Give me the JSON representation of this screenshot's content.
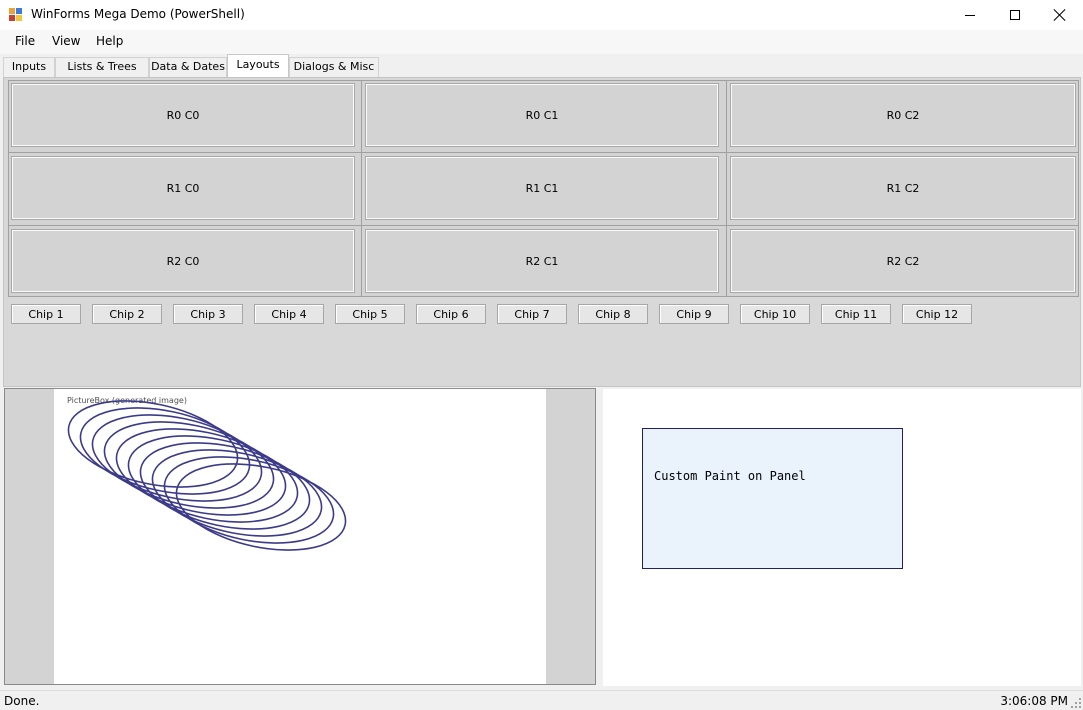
{
  "window": {
    "title": "WinForms Mega Demo (PowerShell)",
    "icon": "app-icon",
    "controls": [
      "minimize-icon",
      "maximize-icon",
      "close-icon"
    ]
  },
  "menu": {
    "items": [
      {
        "label": "File"
      },
      {
        "label": "View"
      },
      {
        "label": "Help"
      }
    ]
  },
  "tabs": [
    {
      "label": "Inputs",
      "active": false
    },
    {
      "label": "Lists & Trees",
      "active": false
    },
    {
      "label": "Data & Dates",
      "active": false
    },
    {
      "label": "Layouts",
      "active": true
    },
    {
      "label": "Dialogs & Misc",
      "active": false
    }
  ],
  "grid": {
    "rows": [
      [
        "R0 C0",
        "R0 C1",
        "R0 C2"
      ],
      [
        "R1 C0",
        "R1 C1",
        "R1 C2"
      ],
      [
        "R2 C0",
        "R2 C1",
        "R2 C2"
      ]
    ]
  },
  "chips": [
    "Chip 1",
    "Chip 2",
    "Chip 3",
    "Chip 4",
    "Chip 5",
    "Chip 6",
    "Chip 7",
    "Chip 8",
    "Chip 9",
    "Chip 10",
    "Chip 11",
    "Chip 12"
  ],
  "picturebox": {
    "caption": "PictureBox (generated image)",
    "ellipse_count": 10,
    "stroke_color": "#3c3b8a"
  },
  "custom_panel": {
    "text": "Custom Paint on Panel",
    "fill_color": "#eaf3fc",
    "border_color": "#1f1f6b"
  },
  "status": {
    "text": "Done.",
    "time": "3:06:08 PM"
  }
}
